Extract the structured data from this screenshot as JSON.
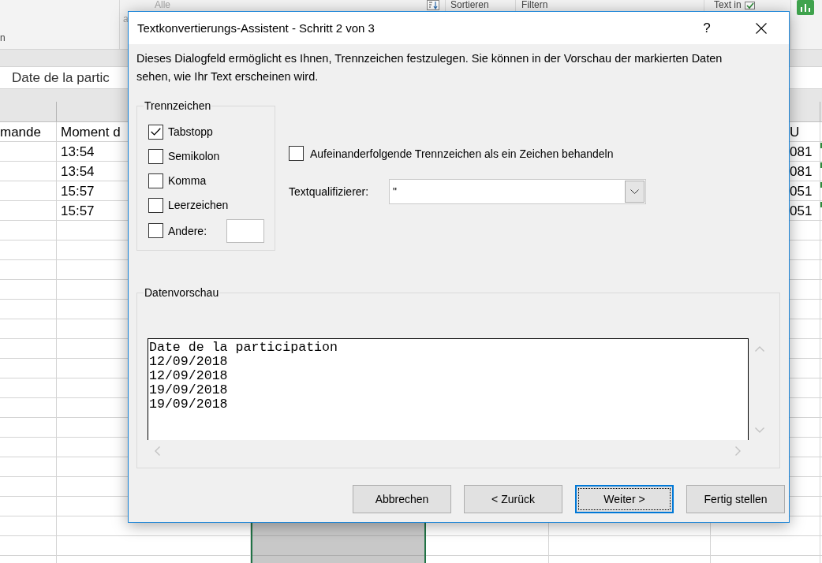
{
  "ribbon": {
    "group_caption": "n",
    "commands": [
      {
        "label": "Alle",
        "disabled": true
      },
      {
        "label": "a",
        "disabled": true
      },
      {
        "label": "Sortieren",
        "disabled": false
      },
      {
        "label": "Filtern",
        "disabled": false
      },
      {
        "label": "Text in",
        "disabled": false
      }
    ]
  },
  "sheet": {
    "formula_bar": {
      "value": "Date de la partic"
    },
    "rows": [
      {
        "column_1": "mande",
        "column_2": "Moment d",
        "column_3": "U",
        "error_marker": false
      },
      {
        "column_2": "13:54",
        "column_3": "081",
        "error_marker": true
      },
      {
        "column_2": "13:54",
        "column_3": "081",
        "error_marker": true
      },
      {
        "column_2": "15:57",
        "column_3": "051",
        "error_marker": true
      },
      {
        "column_2": "15:57",
        "column_3": "051",
        "error_marker": true
      }
    ]
  },
  "dialog": {
    "title": "Textkonvertierungs-Assistent - Schritt 2 von 3",
    "help_button": "?",
    "description": "Dieses Dialogfeld ermöglicht es Ihnen, Trennzeichen festzulegen. Sie können in der Vorschau der markierten Daten sehen, wie Ihr Text erscheinen wird.",
    "delimiters": {
      "title": "Trennzeichen",
      "options": [
        {
          "label": "Tabstopp",
          "checked": true,
          "kind": "plain"
        },
        {
          "label": "Semikolon",
          "checked": false,
          "kind": "plain"
        },
        {
          "label": "Komma",
          "checked": false,
          "kind": "plain"
        },
        {
          "label": "Leerzeichen",
          "checked": false,
          "kind": "plain"
        },
        {
          "label": "Andere:",
          "checked": false,
          "kind": "with-field"
        }
      ]
    },
    "consecutive": {
      "label": "Aufeinanderfolgende Trennzeichen als ein Zeichen behandeln",
      "checked": false
    },
    "text_qualifier": {
      "label": "Textqualifizierer:",
      "value": "\""
    },
    "preview": {
      "title": "Datenvorschau",
      "lines": [
        "Date de la participation",
        "12/09/2018",
        "12/09/2018",
        "19/09/2018",
        "19/09/2018"
      ]
    },
    "buttons": [
      {
        "label": "Abbrechen",
        "focused": false
      },
      {
        "label": "< Zurück",
        "focused": false
      },
      {
        "label": "Weiter >",
        "focused": true
      },
      {
        "label": "Fertig stellen",
        "focused": false
      }
    ]
  }
}
